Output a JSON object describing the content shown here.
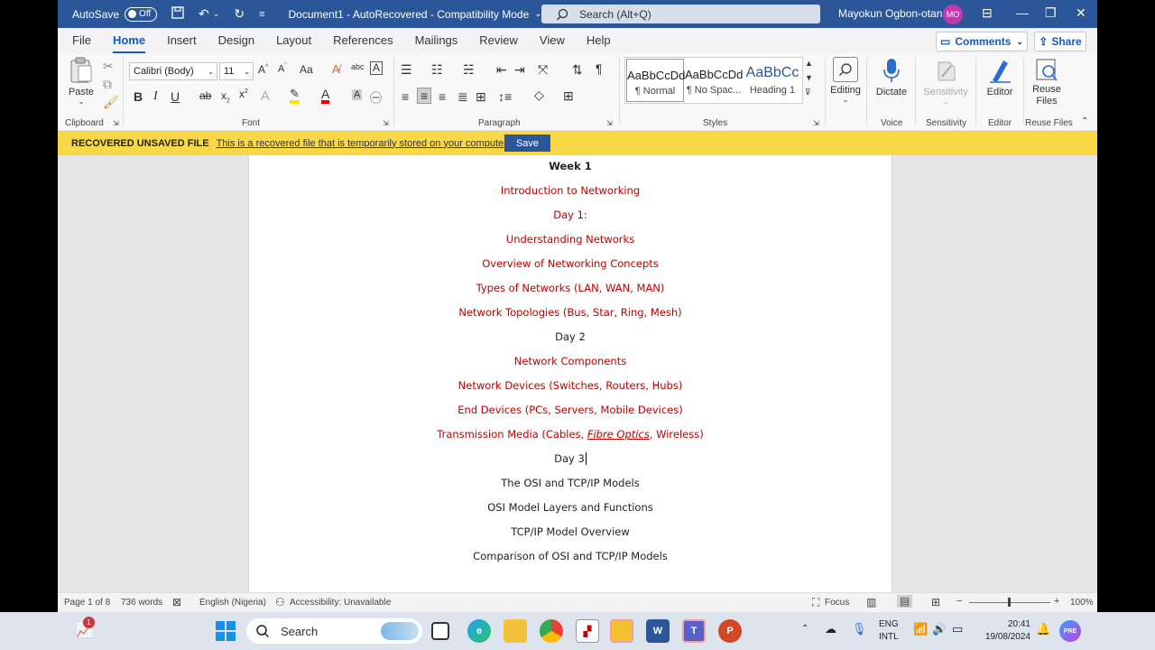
{
  "titlebar": {
    "autosave_label": "AutoSave",
    "autosave_state": "Off",
    "doc_title": "Document1  -  AutoRecovered  -  Compatibility Mode",
    "search_placeholder": "Search (Alt+Q)",
    "user_name": "Mayokun Ogbon-otan",
    "user_initials": "MO"
  },
  "menu": {
    "tabs": [
      "File",
      "Home",
      "Insert",
      "Design",
      "Layout",
      "References",
      "Mailings",
      "Review",
      "View",
      "Help"
    ],
    "comments_label": "Comments",
    "share_label": "Share"
  },
  "ribbon": {
    "paste_label": "Paste",
    "clipboard_label": "Clipboard",
    "font_name": "Calibri (Body)",
    "font_size": "11",
    "font_label": "Font",
    "paragraph_label": "Paragraph",
    "styles_label": "Styles",
    "styles": [
      {
        "preview": "AaBbCcDd",
        "name": "¶ Normal"
      },
      {
        "preview": "AaBbCcDd",
        "name": "¶ No Spac..."
      },
      {
        "preview": "AaBbCc",
        "name": "Heading 1"
      }
    ],
    "editing_label": "Editing",
    "dictate_label": "Dictate",
    "voice_label": "Voice",
    "sensitivity_label": "Sensitivity",
    "sensitivity_group": "Sensitivity",
    "editor_label": "Editor",
    "editor_group": "Editor",
    "reuse_label": "Reuse Files",
    "reuse_group": "Reuse Files"
  },
  "recovery": {
    "title": "RECOVERED UNSAVED FILE",
    "message": "This is a recovered file that is temporarily stored on your computer.",
    "save_label": "Save"
  },
  "document": {
    "lines": [
      "Week 1",
      "Introduction to Networking",
      "Day 1:",
      "Understanding Networks",
      "Overview of Networking Concepts",
      "Types of Networks (LAN, WAN, MAN)",
      "Network Topologies (Bus, Star, Ring, Mesh)",
      "Day 2",
      "Network Components",
      "Network Devices (Switches, Routers, Hubs)",
      "End Devices (PCs, Servers, Mobile Devices)",
      "Transmission Media (Cables, ",
      "Day 3",
      "The OSI and TCP/IP Models",
      "OSI Model Layers and Functions",
      "TCP/IP Model Overview",
      "Comparison of OSI and TCP/IP Models"
    ],
    "transmission_italic": "Fibre Optics",
    "transmission_tail": ", Wireless)",
    "red_color": "#c00000"
  },
  "statusbar": {
    "page": "Page 1 of 8",
    "words": "736 words",
    "language": "English (Nigeria)",
    "accessibility": "Accessibility: Unavailable",
    "focus": "Focus",
    "zoom": "100%"
  },
  "taskbar": {
    "search_placeholder": "Search",
    "badge": "1",
    "lang_top": "ENG",
    "lang_bottom": "INTL",
    "time": "20:41",
    "date": "19/08/2024"
  },
  "colors": {
    "titlebar": "#2b579a",
    "accent": "#185abd",
    "recovery_bar": "#f9d848"
  }
}
